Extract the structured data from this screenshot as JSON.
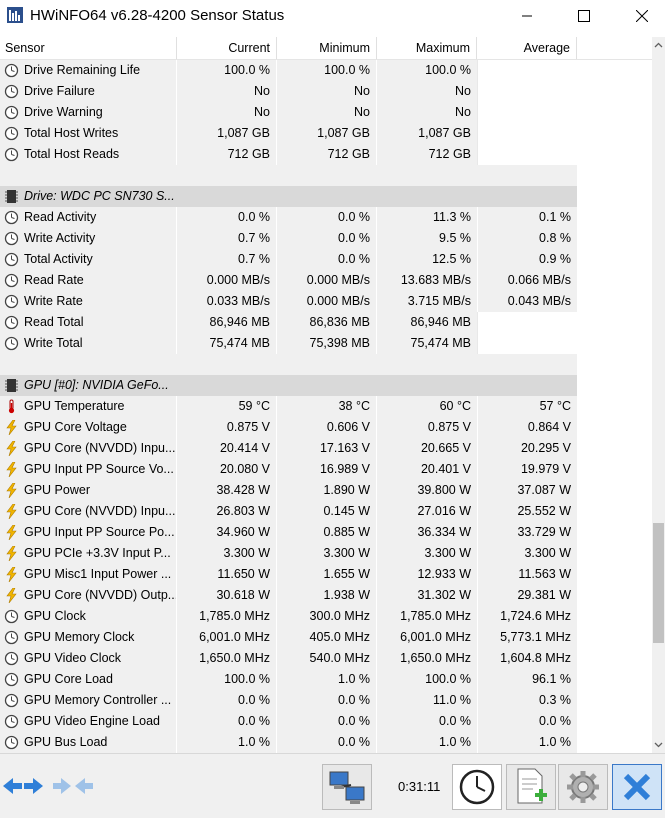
{
  "window": {
    "title": "HWiNFO64 v6.28-4200 Sensor Status"
  },
  "columns": [
    "Sensor",
    "Current",
    "Minimum",
    "Maximum",
    "Average"
  ],
  "rows": [
    {
      "kind": "sensor",
      "icon": "clock-icon",
      "name": "Drive Remaining Life",
      "cur": "100.0 %",
      "min": "100.0 %",
      "max": "100.0 %",
      "avg": ""
    },
    {
      "kind": "sensor",
      "icon": "clock-icon",
      "name": "Drive Failure",
      "cur": "No",
      "min": "No",
      "max": "No",
      "avg": ""
    },
    {
      "kind": "sensor",
      "icon": "clock-icon",
      "name": "Drive Warning",
      "cur": "No",
      "min": "No",
      "max": "No",
      "avg": ""
    },
    {
      "kind": "sensor",
      "icon": "clock-icon",
      "name": "Total Host Writes",
      "cur": "1,087 GB",
      "min": "1,087 GB",
      "max": "1,087 GB",
      "avg": ""
    },
    {
      "kind": "sensor",
      "icon": "clock-icon",
      "name": "Total Host Reads",
      "cur": "712 GB",
      "min": "712 GB",
      "max": "712 GB",
      "avg": ""
    },
    {
      "kind": "spacer"
    },
    {
      "kind": "group",
      "icon": "chip-icon",
      "name": "Drive: WDC PC SN730 S..."
    },
    {
      "kind": "sensor",
      "icon": "clock-icon",
      "name": "Read Activity",
      "cur": "0.0 %",
      "min": "0.0 %",
      "max": "11.3 %",
      "avg": "0.1 %"
    },
    {
      "kind": "sensor",
      "icon": "clock-icon",
      "name": "Write Activity",
      "cur": "0.7 %",
      "min": "0.0 %",
      "max": "9.5 %",
      "avg": "0.8 %"
    },
    {
      "kind": "sensor",
      "icon": "clock-icon",
      "name": "Total Activity",
      "cur": "0.7 %",
      "min": "0.0 %",
      "max": "12.5 %",
      "avg": "0.9 %"
    },
    {
      "kind": "sensor",
      "icon": "clock-icon",
      "name": "Read Rate",
      "cur": "0.000 MB/s",
      "min": "0.000 MB/s",
      "max": "13.683 MB/s",
      "avg": "0.066 MB/s"
    },
    {
      "kind": "sensor",
      "icon": "clock-icon",
      "name": "Write Rate",
      "cur": "0.033 MB/s",
      "min": "0.000 MB/s",
      "max": "3.715 MB/s",
      "avg": "0.043 MB/s"
    },
    {
      "kind": "sensor",
      "icon": "clock-icon",
      "name": "Read Total",
      "cur": "86,946 MB",
      "min": "86,836 MB",
      "max": "86,946 MB",
      "avg": ""
    },
    {
      "kind": "sensor",
      "icon": "clock-icon",
      "name": "Write Total",
      "cur": "75,474 MB",
      "min": "75,398 MB",
      "max": "75,474 MB",
      "avg": ""
    },
    {
      "kind": "spacer"
    },
    {
      "kind": "group",
      "icon": "chip-icon",
      "name": "GPU [#0]: NVIDIA GeFo..."
    },
    {
      "kind": "sensor",
      "icon": "thermometer-icon",
      "name": "GPU Temperature",
      "cur": "59 °C",
      "min": "38 °C",
      "max": "60 °C",
      "avg": "57 °C"
    },
    {
      "kind": "sensor",
      "icon": "lightning-icon",
      "name": "GPU Core Voltage",
      "cur": "0.875 V",
      "min": "0.606 V",
      "max": "0.875 V",
      "avg": "0.864 V"
    },
    {
      "kind": "sensor",
      "icon": "lightning-icon",
      "name": "GPU Core (NVVDD) Inpu...",
      "cur": "20.414 V",
      "min": "17.163 V",
      "max": "20.665 V",
      "avg": "20.295 V"
    },
    {
      "kind": "sensor",
      "icon": "lightning-icon",
      "name": "GPU Input PP Source Vo...",
      "cur": "20.080 V",
      "min": "16.989 V",
      "max": "20.401 V",
      "avg": "19.979 V"
    },
    {
      "kind": "sensor",
      "icon": "lightning-icon",
      "name": "GPU Power",
      "cur": "38.428 W",
      "min": "1.890 W",
      "max": "39.800 W",
      "avg": "37.087 W"
    },
    {
      "kind": "sensor",
      "icon": "lightning-icon",
      "name": "GPU Core (NVVDD) Inpu...",
      "cur": "26.803 W",
      "min": "0.145 W",
      "max": "27.016 W",
      "avg": "25.552 W"
    },
    {
      "kind": "sensor",
      "icon": "lightning-icon",
      "name": "GPU Input PP Source Po...",
      "cur": "34.960 W",
      "min": "0.885 W",
      "max": "36.334 W",
      "avg": "33.729 W"
    },
    {
      "kind": "sensor",
      "icon": "lightning-icon",
      "name": "GPU PCIe +3.3V Input P...",
      "cur": "3.300 W",
      "min": "3.300 W",
      "max": "3.300 W",
      "avg": "3.300 W"
    },
    {
      "kind": "sensor",
      "icon": "lightning-icon",
      "name": "GPU Misc1 Input Power ...",
      "cur": "11.650 W",
      "min": "1.655 W",
      "max": "12.933 W",
      "avg": "11.563 W"
    },
    {
      "kind": "sensor",
      "icon": "lightning-icon",
      "name": "GPU Core (NVVDD) Outp...",
      "cur": "30.618 W",
      "min": "1.938 W",
      "max": "31.302 W",
      "avg": "29.381 W"
    },
    {
      "kind": "sensor",
      "icon": "clock-icon",
      "name": "GPU Clock",
      "cur": "1,785.0 MHz",
      "min": "300.0 MHz",
      "max": "1,785.0 MHz",
      "avg": "1,724.6 MHz"
    },
    {
      "kind": "sensor",
      "icon": "clock-icon",
      "name": "GPU Memory Clock",
      "cur": "6,001.0 MHz",
      "min": "405.0 MHz",
      "max": "6,001.0 MHz",
      "avg": "5,773.1 MHz"
    },
    {
      "kind": "sensor",
      "icon": "clock-icon",
      "name": "GPU Video Clock",
      "cur": "1,650.0 MHz",
      "min": "540.0 MHz",
      "max": "1,650.0 MHz",
      "avg": "1,604.8 MHz"
    },
    {
      "kind": "sensor",
      "icon": "clock-icon",
      "name": "GPU Core Load",
      "cur": "100.0 %",
      "min": "1.0 %",
      "max": "100.0 %",
      "avg": "96.1 %"
    },
    {
      "kind": "sensor",
      "icon": "clock-icon",
      "name": "GPU Memory Controller ...",
      "cur": "0.0 %",
      "min": "0.0 %",
      "max": "11.0 %",
      "avg": "0.3 %"
    },
    {
      "kind": "sensor",
      "icon": "clock-icon",
      "name": "GPU Video Engine Load",
      "cur": "0.0 %",
      "min": "0.0 %",
      "max": "0.0 %",
      "avg": "0.0 %"
    },
    {
      "kind": "sensor",
      "icon": "clock-icon",
      "name": "GPU Bus Load",
      "cur": "1.0 %",
      "min": "0.0 %",
      "max": "1.0 %",
      "avg": "1.0 %"
    }
  ],
  "toolbar": {
    "elapsed": "0:31:11"
  }
}
